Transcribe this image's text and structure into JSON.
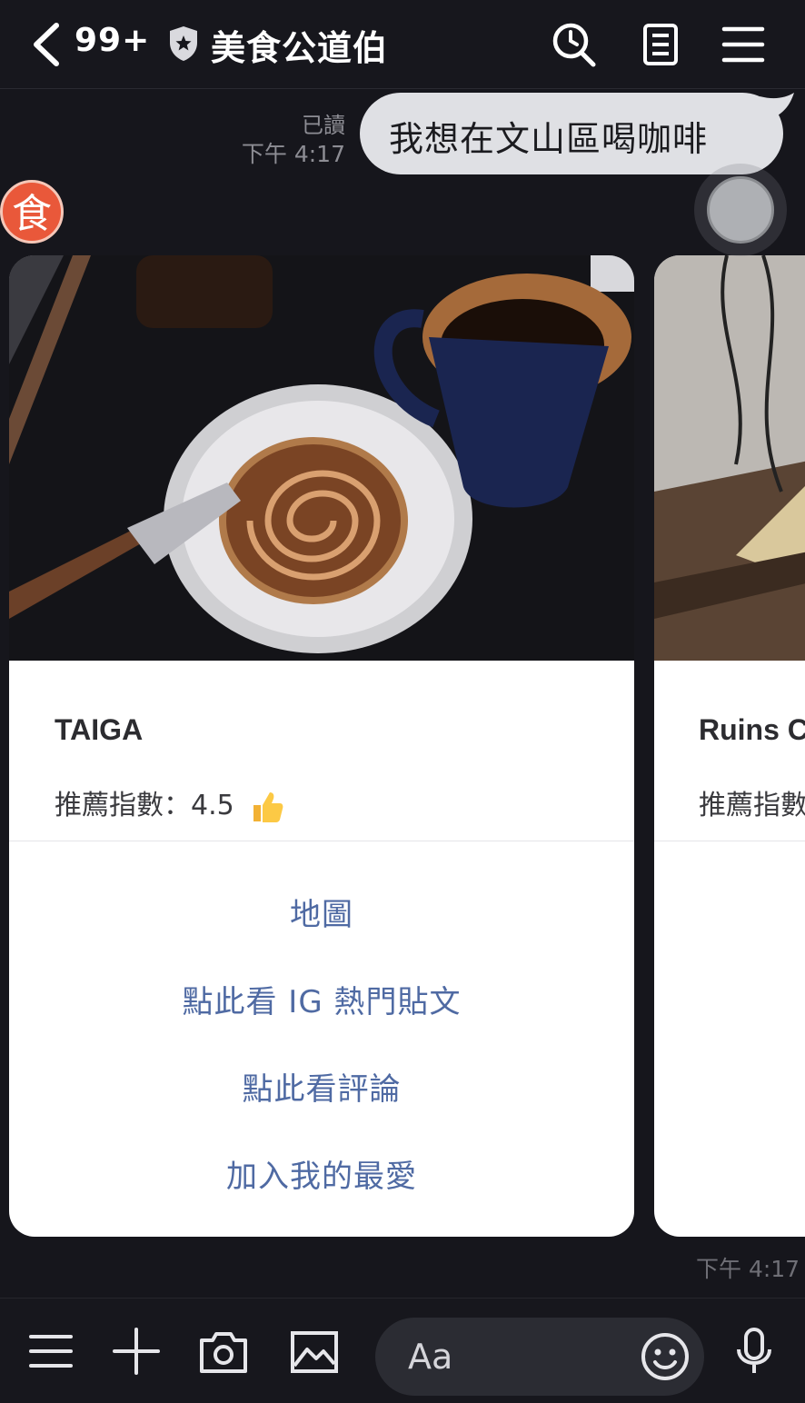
{
  "header": {
    "unread_count": "99+",
    "title": "美食公道伯"
  },
  "messages": {
    "sent": {
      "read_label": "已讀",
      "time": "下午 4:17",
      "text": "我想在文山區喝咖啡"
    },
    "bot_avatar_text": "食",
    "received_time": "下午 4:17"
  },
  "cards": [
    {
      "title": "TAIGA",
      "rating": "推薦指數：4.5",
      "actions": [
        "地圖",
        "點此看 IG 熱門貼文",
        "點此看評論",
        "加入我的最愛"
      ]
    },
    {
      "title": "Ruins C",
      "rating": "推薦指數"
    }
  ],
  "input": {
    "placeholder": "Aa"
  },
  "icons": {
    "back": "chevron-left-icon",
    "shield": "shield-icon",
    "search": "search-clock-icon",
    "notes": "notes-icon",
    "menu": "hamburger-icon",
    "plus": "plus-icon",
    "camera": "camera-icon",
    "image": "image-icon",
    "emoji": "emoji-icon",
    "mic": "mic-icon",
    "thumb": "thumbs-up-icon"
  },
  "colors": {
    "background": "#16161c",
    "sent_bubble": "#dfe0e4",
    "link_blue": "#4f6aa3",
    "avatar_orange": "#e9583a"
  }
}
